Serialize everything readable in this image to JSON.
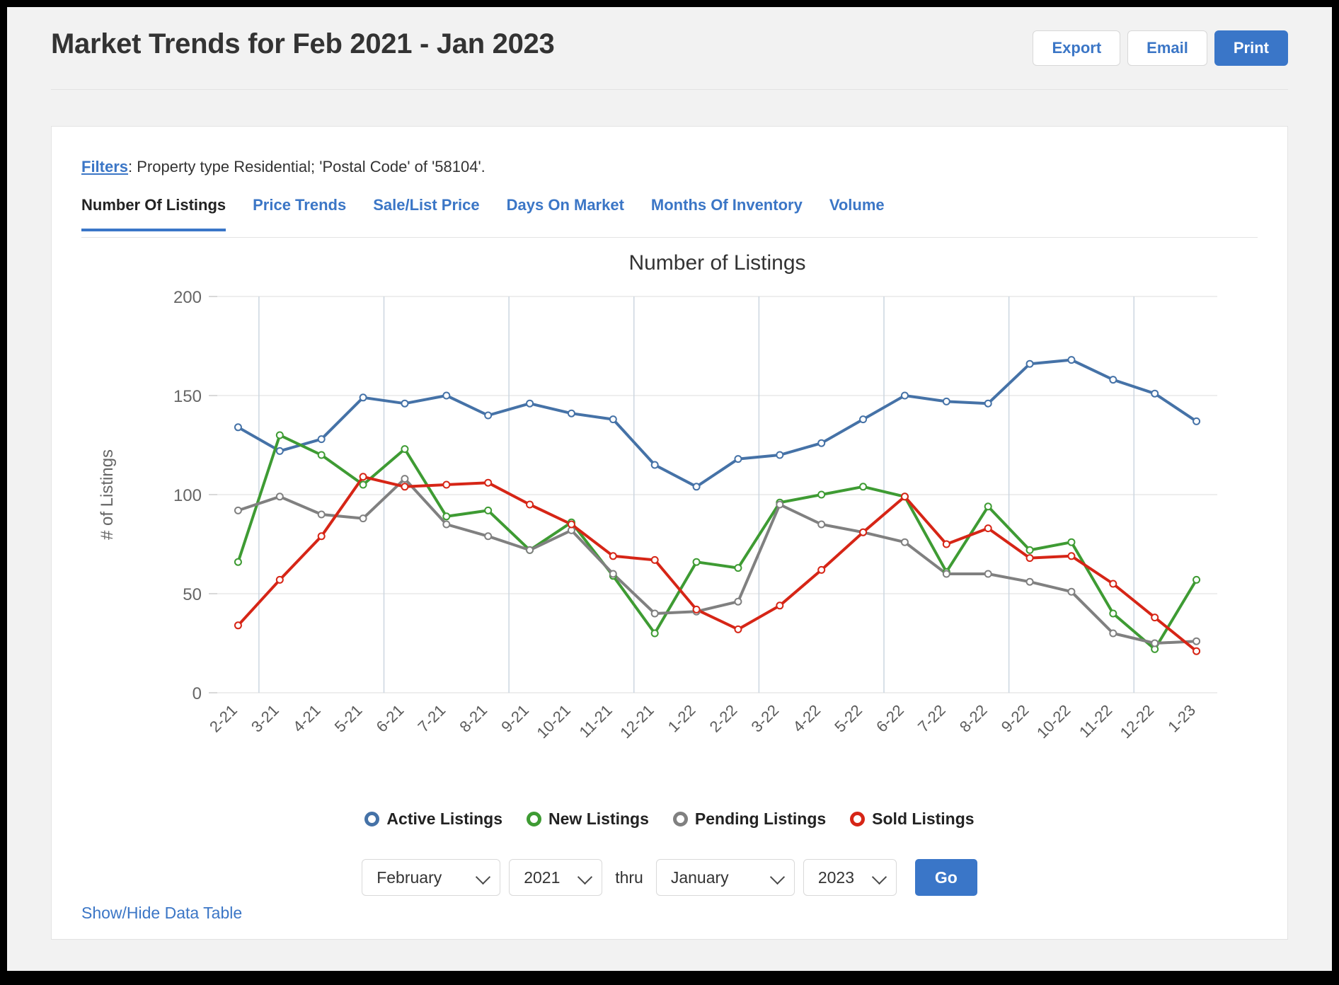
{
  "header": {
    "title": "Market Trends for Feb 2021 - Jan 2023",
    "export_label": "Export",
    "email_label": "Email",
    "print_label": "Print"
  },
  "filters": {
    "link_label": "Filters",
    "description": ": Property type Residential; 'Postal Code' of '58104'."
  },
  "tabs": [
    {
      "label": "Number Of Listings",
      "active": true
    },
    {
      "label": "Price Trends",
      "active": false
    },
    {
      "label": "Sale/List Price",
      "active": false
    },
    {
      "label": "Days On Market",
      "active": false
    },
    {
      "label": "Months Of Inventory",
      "active": false
    },
    {
      "label": "Volume",
      "active": false
    }
  ],
  "controls": {
    "start_month": "February",
    "start_year": "2021",
    "thru_label": "thru",
    "end_month": "January",
    "end_year": "2023",
    "go_label": "Go"
  },
  "footer": {
    "data_table_label": "Show/Hide Data Table"
  },
  "colors": {
    "accent": "#3a76c8",
    "link": "#3b76c6",
    "active_listings": "#4572a7",
    "new_listings": "#3e9b33",
    "pending_listings": "#808080",
    "sold_listings": "#d62516"
  },
  "chart_data": {
    "type": "line",
    "title": "Number of Listings",
    "xlabel": "",
    "ylabel": "# of Listings",
    "ylim": [
      0,
      200
    ],
    "yticks": [
      0,
      50,
      100,
      150,
      200
    ],
    "grid": true,
    "legend_position": "bottom",
    "categories": [
      "2-21",
      "3-21",
      "4-21",
      "5-21",
      "6-21",
      "7-21",
      "8-21",
      "9-21",
      "10-21",
      "11-21",
      "12-21",
      "1-22",
      "2-22",
      "3-22",
      "4-22",
      "5-22",
      "6-22",
      "7-22",
      "8-22",
      "9-22",
      "10-22",
      "11-22",
      "12-22",
      "1-23"
    ],
    "series": [
      {
        "name": "Active Listings",
        "color": "#4572a7",
        "values": [
          134,
          122,
          128,
          149,
          146,
          150,
          140,
          146,
          141,
          138,
          115,
          104,
          118,
          120,
          126,
          138,
          150,
          147,
          146,
          166,
          168,
          158,
          151,
          137
        ]
      },
      {
        "name": "New Listings",
        "color": "#3e9b33",
        "values": [
          66,
          130,
          120,
          105,
          123,
          89,
          92,
          72,
          86,
          59,
          30,
          66,
          63,
          96,
          100,
          104,
          99,
          61,
          94,
          72,
          76,
          40,
          22,
          57
        ]
      },
      {
        "name": "Pending Listings",
        "color": "#808080",
        "values": [
          92,
          99,
          90,
          88,
          108,
          85,
          79,
          72,
          82,
          60,
          40,
          41,
          46,
          95,
          85,
          81,
          76,
          60,
          60,
          56,
          51,
          30,
          25,
          26
        ]
      },
      {
        "name": "Sold Listings",
        "color": "#d62516",
        "values": [
          34,
          57,
          79,
          109,
          104,
          105,
          106,
          95,
          85,
          69,
          67,
          42,
          32,
          44,
          62,
          81,
          99,
          75,
          83,
          68,
          69,
          55,
          38,
          21
        ]
      }
    ]
  }
}
